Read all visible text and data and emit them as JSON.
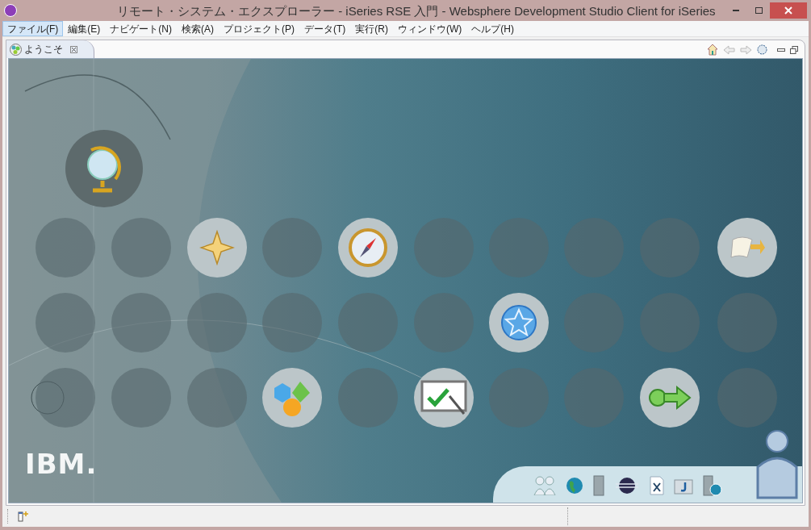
{
  "window": {
    "title": "リモート・システム・エクスプローラー - iSeries RSE 入門 - Websphere Development Studio Client for iSeries"
  },
  "menu": [
    {
      "label": "ファイル(F)",
      "selected": true
    },
    {
      "label": "編集(E)",
      "selected": false
    },
    {
      "label": "ナビゲート(N)",
      "selected": false
    },
    {
      "label": "検索(A)",
      "selected": false
    },
    {
      "label": "プロジェクト(P)",
      "selected": false
    },
    {
      "label": "データ(T)",
      "selected": false
    },
    {
      "label": "実行(R)",
      "selected": false
    },
    {
      "label": "ウィンドウ(W)",
      "selected": false
    },
    {
      "label": "ヘルプ(H)",
      "selected": false
    }
  ],
  "tab": {
    "label": "ようこそ"
  },
  "logo": "IBM."
}
